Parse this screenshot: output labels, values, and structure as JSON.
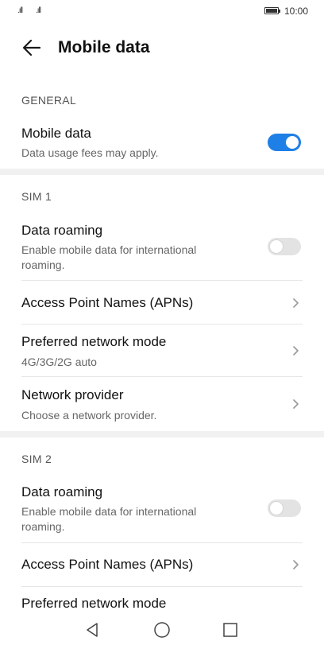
{
  "status_bar": {
    "time": "10:00",
    "signal1": ".ıll",
    "signal2": ".ıll",
    "battery_level": 1.0
  },
  "header": {
    "title": "Mobile data"
  },
  "general": {
    "label": "GENERAL",
    "mobile_data": {
      "title": "Mobile data",
      "subtitle": "Data usage fees may apply.",
      "enabled": true
    }
  },
  "sim1": {
    "label": "SIM 1",
    "data_roaming": {
      "title": "Data roaming",
      "subtitle": "Enable mobile data for international roaming.",
      "enabled": false
    },
    "apn": {
      "title": "Access Point Names (APNs)"
    },
    "network_mode": {
      "title": "Preferred network mode",
      "subtitle": "4G/3G/2G auto"
    },
    "network_provider": {
      "title": "Network provider",
      "subtitle": "Choose a network provider."
    }
  },
  "sim2": {
    "label": "SIM 2",
    "data_roaming": {
      "title": "Data roaming",
      "subtitle": "Enable mobile data for international roaming.",
      "enabled": false
    },
    "apn": {
      "title": "Access Point Names (APNs)"
    },
    "network_mode": {
      "title": "Preferred network mode"
    }
  },
  "icons": {
    "back": "arrow-left",
    "chevron": "chevron-right",
    "nav_back": "triangle-left",
    "nav_home": "circle",
    "nav_recent": "square"
  },
  "colors": {
    "accent": "#1e7fe6",
    "toggle_off": "#e3e3e3",
    "section_gap": "#f1f1f1"
  }
}
